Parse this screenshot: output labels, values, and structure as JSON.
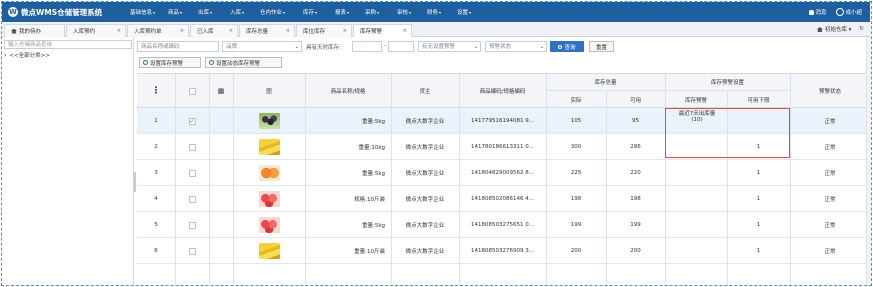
{
  "app": {
    "title": "微点WMS仓储管理系统",
    "logo_letter": "W"
  },
  "menu": [
    {
      "label": "基础信息",
      "caret": true
    },
    {
      "label": "商品",
      "caret": true
    },
    {
      "label": "出库",
      "caret": true
    },
    {
      "label": "入库",
      "caret": true
    },
    {
      "label": "仓内作业",
      "caret": true
    },
    {
      "label": "库存",
      "caret": true
    },
    {
      "label": "报表",
      "caret": true
    },
    {
      "label": "采购",
      "caret": true
    },
    {
      "label": "审核",
      "caret": true
    },
    {
      "label": "财务",
      "caret": true
    },
    {
      "label": "设置",
      "caret": true
    }
  ],
  "user": {
    "notifications": "消息",
    "name": "成小超"
  },
  "tabs": [
    {
      "label": "我的待办",
      "closable": false
    },
    {
      "label": "入库预约",
      "closable": true
    },
    {
      "label": "入库预约单",
      "closable": true
    },
    {
      "label": "已入库",
      "closable": true
    },
    {
      "label": "库存总量",
      "closable": true
    },
    {
      "label": "库位库存",
      "closable": true
    },
    {
      "label": "库存预警",
      "closable": true,
      "active": true
    }
  ],
  "tab_right": {
    "warehouse": "初始仓库"
  },
  "sidebar": {
    "search_placeholder": "输入仓储商品查询",
    "tree_root": "<<全部分类>>"
  },
  "filters": {
    "product_placeholder": "商品名称或编码",
    "brand_placeholder": "品牌",
    "days_label": "具有天时库存:",
    "days_from": "",
    "days_to": "",
    "warning_select": "有无设置预警",
    "status_select": "预警状态",
    "query_btn": "查询",
    "reset_btn": "重置"
  },
  "actions": {
    "set_warning": "设置库存预警",
    "set_dynamic": "设置动态库存预警"
  },
  "table": {
    "headers": {
      "image": "图",
      "name": "商品名称/规格",
      "owner": "货主",
      "code": "商品编码/规格编码",
      "stock_group": "库存总量",
      "actual": "实际",
      "available": "可用",
      "warn_group": "库存预警设置",
      "warn": "库存预警",
      "lower": "可用下限",
      "status": "预警状态"
    },
    "rows": [
      {
        "no": "1",
        "checked": true,
        "image": "grapes",
        "name": "重量:5kg",
        "owner": "微点大数字企业",
        "code": "141779516194081 9...",
        "actual": "105",
        "available": "95",
        "warn": "最近7天出库量\n(10)",
        "lower": "",
        "status": "正常"
      },
      {
        "no": "2",
        "checked": false,
        "image": "bananas",
        "name": "重量:10kg",
        "owner": "微点大数字企业",
        "code": "141780186613311 0...",
        "actual": "300",
        "available": "286",
        "warn": "",
        "lower": "1",
        "status": "正常"
      },
      {
        "no": "3",
        "checked": false,
        "image": "oranges",
        "name": "重量:5kg",
        "owner": "微点大数字企业",
        "code": "141804829009562 8...",
        "actual": "225",
        "available": "220",
        "warn": "",
        "lower": "1",
        "status": "正常"
      },
      {
        "no": "4",
        "checked": false,
        "image": "apples",
        "name": "规格:10斤装",
        "owner": "微点大数字企业",
        "code": "141808502086146 4...",
        "actual": "198",
        "available": "198",
        "warn": "",
        "lower": "1",
        "status": "正常"
      },
      {
        "no": "5",
        "checked": false,
        "image": "apples",
        "name": "重量:5kg",
        "owner": "微点大数字企业",
        "code": "141808503275651 0...",
        "actual": "199",
        "available": "199",
        "warn": "",
        "lower": "1",
        "status": "正常"
      },
      {
        "no": "6",
        "checked": false,
        "image": "bananas",
        "name": "重量:10斤装",
        "owner": "微点大数字企业",
        "code": "141808503276909 3...",
        "actual": "200",
        "available": "200",
        "warn": "",
        "lower": "1",
        "status": "正常"
      }
    ]
  },
  "colors": {
    "brand": "#1e5fa0",
    "accent": "#2f71c4",
    "highlight_box": "#e24b3b"
  }
}
